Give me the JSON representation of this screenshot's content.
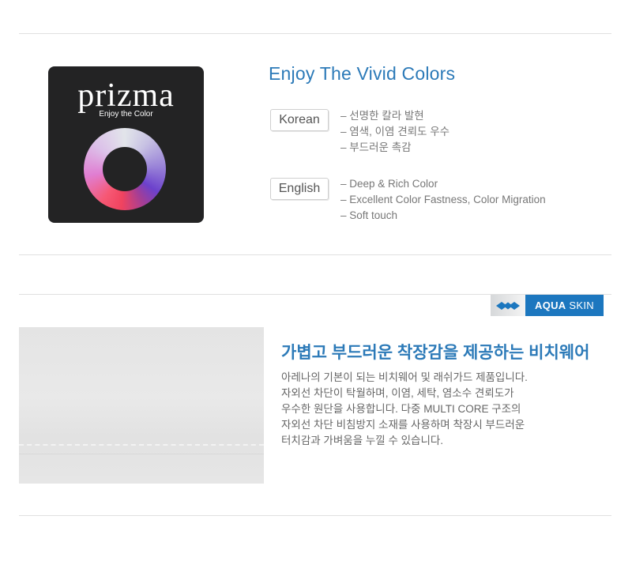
{
  "prizma": {
    "brand": "prizma",
    "tagline": "Enjoy the Color"
  },
  "section1": {
    "title": "Enjoy The Vivid Colors",
    "korean": {
      "label": "Korean",
      "items": [
        "선명한 칼라 발현",
        "염색, 이염 견뢰도 우수",
        "부드러운 촉감"
      ]
    },
    "english": {
      "label": "English",
      "items": [
        "Deep & Rich Color",
        "Excellent Color Fastness, Color Migration",
        "Soft touch"
      ]
    }
  },
  "section2": {
    "badge_bold": "AQUA",
    "badge_light": "SKIN",
    "title": "가볍고 부드러운 착장감을 제공하는 비치웨어",
    "lines": [
      "아레나의 기본이 되는 비치웨어 및 래쉬가드 제품입니다.",
      "자외선 차단이 탁월하며, 이염, 세탁, 염소수 견뢰도가",
      "우수한 원단을 사용합니다. 다중 MULTI CORE 구조의",
      "자외선 차단 비침방지 소재를 사용하며 착장시 부드러운",
      "터치감과 가벼움을 누낄 수 있습니다."
    ]
  },
  "colors": {
    "accent": "#2c7ab8",
    "badge_blue": "#1c77bf",
    "logo_bg": "#232324"
  }
}
